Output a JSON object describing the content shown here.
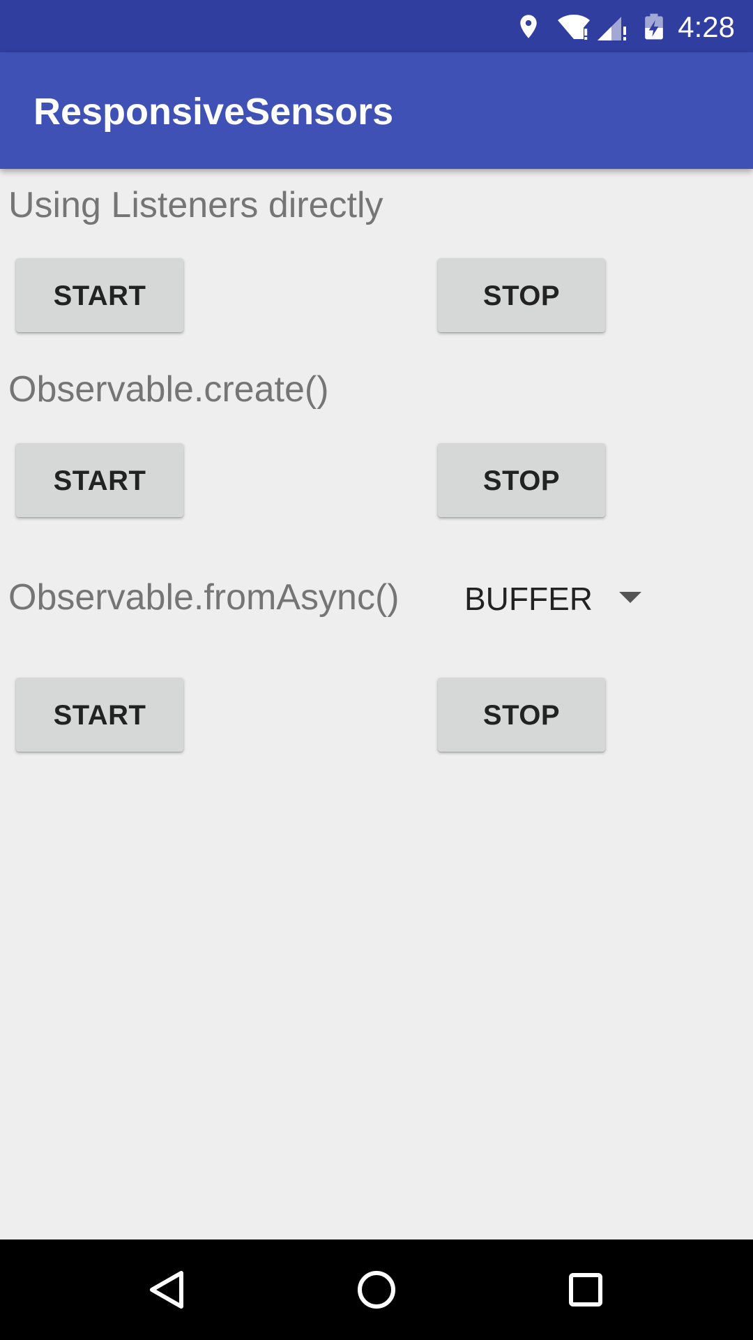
{
  "status_bar": {
    "time": "4:28",
    "icons": [
      "location-icon",
      "wifi-icon",
      "cell-signal-icon",
      "battery-charging-icon"
    ],
    "background_color": "#303f9f"
  },
  "app_bar": {
    "title": "ResponsiveSensors",
    "background_color": "#3f51b5"
  },
  "sections": [
    {
      "label": "Using Listeners directly",
      "start_label": "START",
      "stop_label": "STOP"
    },
    {
      "label": "Observable.create()",
      "start_label": "START",
      "stop_label": "STOP"
    },
    {
      "label": "Observable.fromAsync()",
      "start_label": "START",
      "stop_label": "STOP",
      "spinner_value": "BUFFER"
    }
  ],
  "nav_bar": {
    "icons": [
      "back-icon",
      "home-icon",
      "recents-icon"
    ]
  }
}
